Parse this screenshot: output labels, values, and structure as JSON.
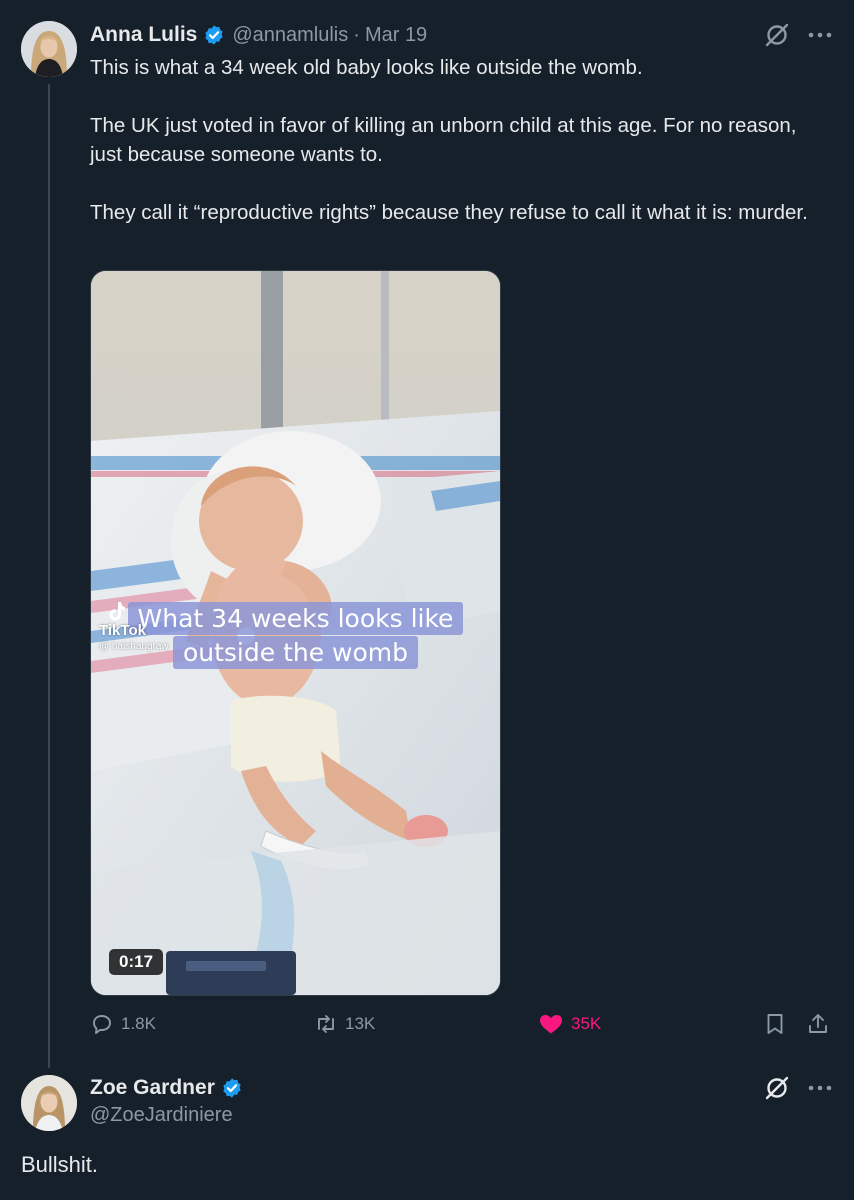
{
  "tweet": {
    "author": {
      "name": "Anna Lulis",
      "handle": "@annamlulis",
      "separator": "·",
      "date": "Mar 19",
      "verified": true
    },
    "paragraphs": [
      "This is what a 34 week old baby looks like outside the womb.",
      "The UK just voted in favor of killing an unborn child at this age. For no reason, just because someone wants to.",
      "They call it “reproductive rights” because they refuse to call it what it is: murder."
    ],
    "media": {
      "caption_line1": "What 34 weeks looks like",
      "caption_line2": "outside the womb",
      "watermark_brand": "TikTok",
      "watermark_user": "@ haishangraw",
      "duration": "0:17"
    },
    "metrics": {
      "replies": "1.8K",
      "reposts": "13K",
      "likes": "35K",
      "liked": true
    },
    "icons": [
      "grok-icon",
      "more-icon",
      "reply-icon",
      "repost-icon",
      "heart-icon",
      "bookmark-icon",
      "share-icon"
    ]
  },
  "reply": {
    "author": {
      "name": "Zoe Gardner",
      "handle": "@ZoeJardiniere",
      "verified": true
    },
    "text": "Bullshit."
  },
  "colors": {
    "background": "#16202b",
    "text": "#e7e9ea",
    "muted": "#8b98a5",
    "verified": "#1d9bf0",
    "like": "#f91880",
    "thread_line": "#3a4754"
  }
}
